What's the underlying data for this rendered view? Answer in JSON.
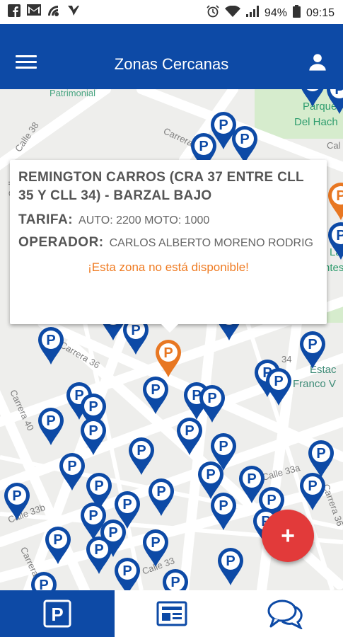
{
  "status_bar": {
    "battery": "94%",
    "time": "09:15"
  },
  "app_bar": {
    "title": "Zonas Cercanas"
  },
  "map_labels": {
    "patrimonial": "Patrimonial",
    "parque_1": "Parque",
    "parque_2": "Del Hach",
    "calle_38": "Calle 38",
    "carrera_top": "Carrera",
    "calle_right": "Cal",
    "carrera_36": "Carrera 36",
    "carrera_40": "Carrera 40",
    "calle_33b": "Calle 33b",
    "calle_33a": "Calle 33a",
    "calle_33": "Calle 33",
    "carrera_bottom": "Carrera",
    "carrera_36b": "Carrera 36",
    "estac_1": "Estac",
    "estac_2": "Franco V",
    "la": "La",
    "ntes": "ntes",
    "cra_34": "34",
    "calle_side": "Calle"
  },
  "popup": {
    "title": "REMINGTON CARROS  (CRA 37 ENTRE CLL 35 Y CLL 34) - BARZAL BAJO",
    "tarifa_label": "TARIFA:",
    "tarifa_value": "AUTO: 2200 MOTO: 1000",
    "operador_label": "OPERADOR:",
    "operador_value": "CARLOS ALBERTO MORENO RODRIG",
    "warning": "¡Esta zona no está disponible!"
  },
  "fab": {
    "label": "+"
  },
  "bottom_nav": {
    "items": [
      {
        "icon": "parking-icon",
        "active": true
      },
      {
        "icon": "news-icon",
        "active": false
      },
      {
        "icon": "chat-icon",
        "active": false
      }
    ]
  },
  "colors": {
    "primary": "#0d4aa6",
    "pin_blue": "#0d4aa6",
    "pin_orange": "#e87722",
    "fab": "#e23a3a",
    "warning": "#ef7b22"
  }
}
